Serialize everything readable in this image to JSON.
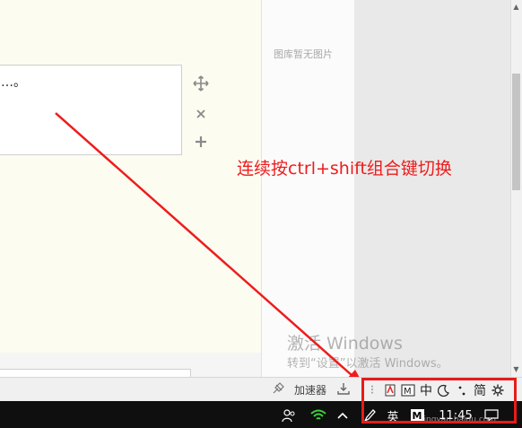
{
  "editor": {
    "box_text": "…。"
  },
  "tools": {
    "move_icon": "move-icon",
    "close_icon": "close-icon",
    "add_icon": "plus-icon"
  },
  "panel": {
    "empty_text": "图库暂无图片"
  },
  "annotation": {
    "text": "连续按ctrl+shift组合键切换",
    "color": "#ee1c1c"
  },
  "activation_watermark": {
    "line1": "激活 Windows",
    "line2": "转到“设置”以激活 Windows。"
  },
  "statusbar": {
    "accelerator_label": "加速器"
  },
  "ime": {
    "mode_zh": "中",
    "simplified": "简",
    "more": "⁝"
  },
  "taskbar": {
    "lang": "英",
    "ime_letter": "M",
    "time": "11:45"
  },
  "site_watermark": "jingyan.baidu.com"
}
